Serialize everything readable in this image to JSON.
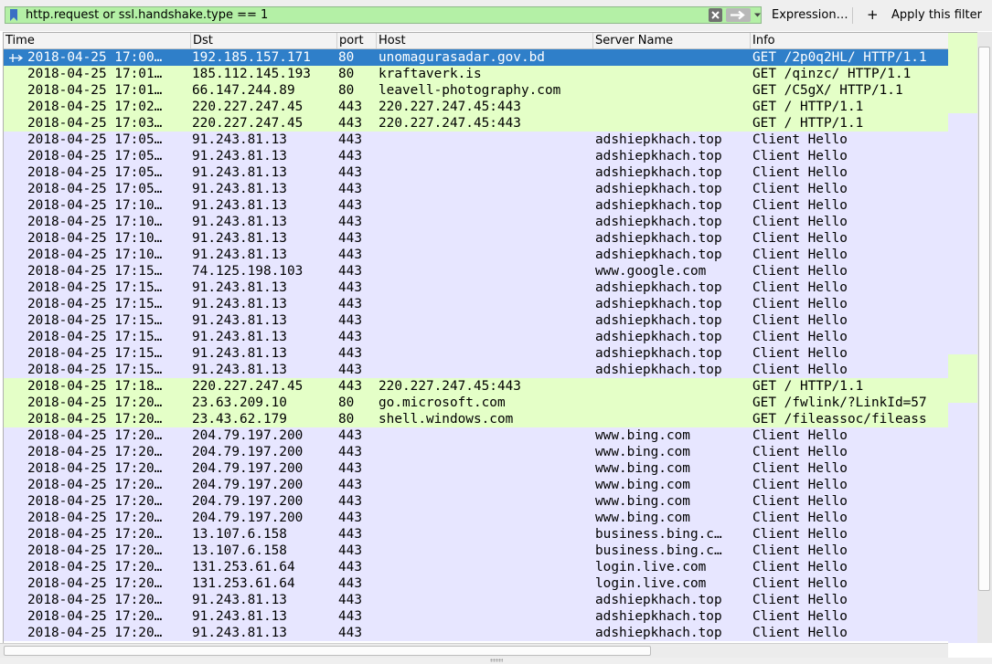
{
  "toolbar": {
    "filter_text": "http.request or ssl.handshake.type == 1",
    "expression_label": "Expression…",
    "plus_label": "+",
    "apply_label": "Apply this filter"
  },
  "columns": [
    "Time",
    "Dst",
    "port",
    "Host",
    "Server Name",
    "Info"
  ],
  "rows": [
    {
      "type": "http",
      "selected": true,
      "time": "2018-04-25 17:00…",
      "dst": "192.185.157.171",
      "port": "80",
      "host": "unomagurasadar.gov.bd",
      "server_name": "",
      "info": "GET /2p0q2HL/ HTTP/1.1"
    },
    {
      "type": "http",
      "time": "2018-04-25 17:01…",
      "dst": "185.112.145.193",
      "port": "80",
      "host": "kraftaverk.is",
      "server_name": "",
      "info": "GET /qinzc/ HTTP/1.1"
    },
    {
      "type": "http",
      "time": "2018-04-25 17:01…",
      "dst": "66.147.244.89",
      "port": "80",
      "host": "leavell-photography.com",
      "server_name": "",
      "info": "GET /C5gX/ HTTP/1.1"
    },
    {
      "type": "http",
      "time": "2018-04-25 17:02…",
      "dst": "220.227.247.45",
      "port": "443",
      "host": "220.227.247.45:443",
      "server_name": "",
      "info": "GET / HTTP/1.1"
    },
    {
      "type": "http",
      "time": "2018-04-25 17:03…",
      "dst": "220.227.247.45",
      "port": "443",
      "host": "220.227.247.45:443",
      "server_name": "",
      "info": "GET / HTTP/1.1"
    },
    {
      "type": "tls",
      "time": "2018-04-25 17:05…",
      "dst": "91.243.81.13",
      "port": "443",
      "host": "",
      "server_name": "adshiepkhach.top",
      "info": "Client Hello"
    },
    {
      "type": "tls",
      "time": "2018-04-25 17:05…",
      "dst": "91.243.81.13",
      "port": "443",
      "host": "",
      "server_name": "adshiepkhach.top",
      "info": "Client Hello"
    },
    {
      "type": "tls",
      "time": "2018-04-25 17:05…",
      "dst": "91.243.81.13",
      "port": "443",
      "host": "",
      "server_name": "adshiepkhach.top",
      "info": "Client Hello"
    },
    {
      "type": "tls",
      "time": "2018-04-25 17:05…",
      "dst": "91.243.81.13",
      "port": "443",
      "host": "",
      "server_name": "adshiepkhach.top",
      "info": "Client Hello"
    },
    {
      "type": "tls",
      "time": "2018-04-25 17:10…",
      "dst": "91.243.81.13",
      "port": "443",
      "host": "",
      "server_name": "adshiepkhach.top",
      "info": "Client Hello"
    },
    {
      "type": "tls",
      "time": "2018-04-25 17:10…",
      "dst": "91.243.81.13",
      "port": "443",
      "host": "",
      "server_name": "adshiepkhach.top",
      "info": "Client Hello"
    },
    {
      "type": "tls",
      "time": "2018-04-25 17:10…",
      "dst": "91.243.81.13",
      "port": "443",
      "host": "",
      "server_name": "adshiepkhach.top",
      "info": "Client Hello"
    },
    {
      "type": "tls",
      "time": "2018-04-25 17:10…",
      "dst": "91.243.81.13",
      "port": "443",
      "host": "",
      "server_name": "adshiepkhach.top",
      "info": "Client Hello"
    },
    {
      "type": "tls",
      "time": "2018-04-25 17:15…",
      "dst": "74.125.198.103",
      "port": "443",
      "host": "",
      "server_name": "www.google.com",
      "info": "Client Hello"
    },
    {
      "type": "tls",
      "time": "2018-04-25 17:15…",
      "dst": "91.243.81.13",
      "port": "443",
      "host": "",
      "server_name": "adshiepkhach.top",
      "info": "Client Hello"
    },
    {
      "type": "tls",
      "time": "2018-04-25 17:15…",
      "dst": "91.243.81.13",
      "port": "443",
      "host": "",
      "server_name": "adshiepkhach.top",
      "info": "Client Hello"
    },
    {
      "type": "tls",
      "time": "2018-04-25 17:15…",
      "dst": "91.243.81.13",
      "port": "443",
      "host": "",
      "server_name": "adshiepkhach.top",
      "info": "Client Hello"
    },
    {
      "type": "tls",
      "time": "2018-04-25 17:15…",
      "dst": "91.243.81.13",
      "port": "443",
      "host": "",
      "server_name": "adshiepkhach.top",
      "info": "Client Hello"
    },
    {
      "type": "tls",
      "time": "2018-04-25 17:15…",
      "dst": "91.243.81.13",
      "port": "443",
      "host": "",
      "server_name": "adshiepkhach.top",
      "info": "Client Hello"
    },
    {
      "type": "tls",
      "time": "2018-04-25 17:15…",
      "dst": "91.243.81.13",
      "port": "443",
      "host": "",
      "server_name": "adshiepkhach.top",
      "info": "Client Hello"
    },
    {
      "type": "http",
      "time": "2018-04-25 17:18…",
      "dst": "220.227.247.45",
      "port": "443",
      "host": "220.227.247.45:443",
      "server_name": "",
      "info": "GET / HTTP/1.1"
    },
    {
      "type": "http",
      "time": "2018-04-25 17:20…",
      "dst": "23.63.209.10",
      "port": "80",
      "host": "go.microsoft.com",
      "server_name": "",
      "info": "GET /fwlink/?LinkId=57"
    },
    {
      "type": "http",
      "time": "2018-04-25 17:20…",
      "dst": "23.43.62.179",
      "port": "80",
      "host": "shell.windows.com",
      "server_name": "",
      "info": "GET /fileassoc/fileass"
    },
    {
      "type": "tls",
      "time": "2018-04-25 17:20…",
      "dst": "204.79.197.200",
      "port": "443",
      "host": "",
      "server_name": "www.bing.com",
      "info": "Client Hello"
    },
    {
      "type": "tls",
      "time": "2018-04-25 17:20…",
      "dst": "204.79.197.200",
      "port": "443",
      "host": "",
      "server_name": "www.bing.com",
      "info": "Client Hello"
    },
    {
      "type": "tls",
      "time": "2018-04-25 17:20…",
      "dst": "204.79.197.200",
      "port": "443",
      "host": "",
      "server_name": "www.bing.com",
      "info": "Client Hello"
    },
    {
      "type": "tls",
      "time": "2018-04-25 17:20…",
      "dst": "204.79.197.200",
      "port": "443",
      "host": "",
      "server_name": "www.bing.com",
      "info": "Client Hello"
    },
    {
      "type": "tls",
      "time": "2018-04-25 17:20…",
      "dst": "204.79.197.200",
      "port": "443",
      "host": "",
      "server_name": "www.bing.com",
      "info": "Client Hello"
    },
    {
      "type": "tls",
      "time": "2018-04-25 17:20…",
      "dst": "204.79.197.200",
      "port": "443",
      "host": "",
      "server_name": "www.bing.com",
      "info": "Client Hello"
    },
    {
      "type": "tls",
      "time": "2018-04-25 17:20…",
      "dst": "13.107.6.158",
      "port": "443",
      "host": "",
      "server_name": "business.bing.c…",
      "info": "Client Hello"
    },
    {
      "type": "tls",
      "time": "2018-04-25 17:20…",
      "dst": "13.107.6.158",
      "port": "443",
      "host": "",
      "server_name": "business.bing.c…",
      "info": "Client Hello"
    },
    {
      "type": "tls",
      "time": "2018-04-25 17:20…",
      "dst": "131.253.61.64",
      "port": "443",
      "host": "",
      "server_name": "login.live.com",
      "info": "Client Hello"
    },
    {
      "type": "tls",
      "time": "2018-04-25 17:20…",
      "dst": "131.253.61.64",
      "port": "443",
      "host": "",
      "server_name": "login.live.com",
      "info": "Client Hello"
    },
    {
      "type": "tls",
      "time": "2018-04-25 17:20…",
      "dst": "91.243.81.13",
      "port": "443",
      "host": "",
      "server_name": "adshiepkhach.top",
      "info": "Client Hello"
    },
    {
      "type": "tls",
      "time": "2018-04-25 17:20…",
      "dst": "91.243.81.13",
      "port": "443",
      "host": "",
      "server_name": "adshiepkhach.top",
      "info": "Client Hello"
    },
    {
      "type": "tls",
      "time": "2018-04-25 17:20…",
      "dst": "91.243.81.13",
      "port": "443",
      "host": "",
      "server_name": "adshiepkhach.top",
      "info": "Client Hello"
    }
  ],
  "colors": {
    "http_row": "#e4ffc7",
    "tls_row": "#e7e6ff",
    "selected_row": "#2f7fc9",
    "filter_valid": "#b4f0a6"
  }
}
